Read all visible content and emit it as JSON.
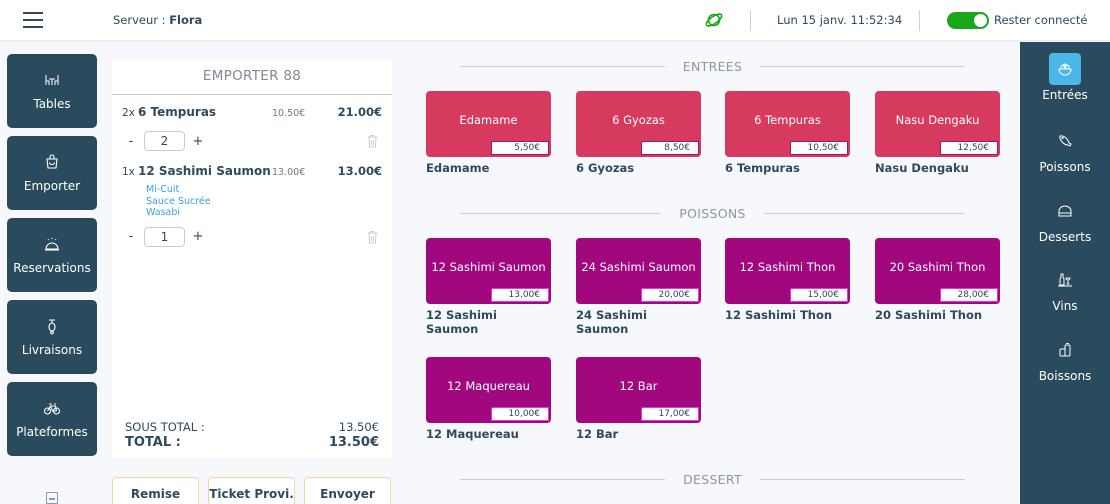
{
  "topbar": {
    "server_label": "Serveur : ",
    "server_name": "Flora",
    "datetime": "Lun 15 janv. 11:52:34",
    "stay_connected_label": "Rester connecté",
    "stay_connected": true,
    "accent_green": "#18a61a"
  },
  "leftnav": [
    {
      "label": "Tables",
      "icon": "table-icon"
    },
    {
      "label": "Emporter",
      "icon": "bag-icon"
    },
    {
      "label": "Reservations",
      "icon": "bell-icon"
    },
    {
      "label": "Livraisons",
      "icon": "scooter-icon"
    },
    {
      "label": "Plateformes",
      "icon": "bicycle-icon"
    }
  ],
  "order": {
    "title": "EMPORTER 88",
    "lines": [
      {
        "qty_label": "2x",
        "name": "6 Tempuras",
        "unit_price": "10.50€",
        "total": "21.00€",
        "options": [],
        "qty": "2"
      },
      {
        "qty_label": "1x",
        "name": "12 Sashimi Saumon",
        "unit_price": "13.00€",
        "total": "13.00€",
        "options": [
          "Mi-Cuit",
          "Sauce Sucrée",
          "Wasabi"
        ],
        "qty": "1"
      }
    ],
    "stepper_minus": "-",
    "stepper_plus": "+",
    "subtotal_label": "SOUS TOTAL :",
    "subtotal_value": "13.50€",
    "total_label": "TOTAL :",
    "total_value": "13.50€"
  },
  "actions": {
    "discount": "Remise",
    "provisional_ticket": "Ticket Provi.",
    "send": "Envoyer"
  },
  "menu": {
    "sections": [
      {
        "title": "ENTREES",
        "color": "#d73a5f",
        "products": [
          {
            "name": "Edamame",
            "price": "5,50€",
            "caption": "Edamame"
          },
          {
            "name": "6 Gyozas",
            "price": "8,50€",
            "caption": "6 Gyozas"
          },
          {
            "name": "6 Tempuras",
            "price": "10,50€",
            "caption": "6 Tempuras"
          },
          {
            "name": "Nasu Dengaku",
            "price": "12,50€",
            "caption": "Nasu Dengaku"
          }
        ]
      },
      {
        "title": "POISSONS",
        "color": "#a2087e",
        "products": [
          {
            "name": "12 Sashimi Saumon",
            "price": "13,00€",
            "caption": "12 Sashimi Saumon"
          },
          {
            "name": "24 Sashimi Saumon",
            "price": "20,00€",
            "caption": "24 Sashimi Saumon"
          },
          {
            "name": "12 Sashimi Thon",
            "price": "15,00€",
            "caption": "12 Sashimi Thon"
          },
          {
            "name": "20 Sashimi Thon",
            "price": "28,00€",
            "caption": "20 Sashimi Thon"
          },
          {
            "name": "12 Maquereau",
            "price": "10,00€",
            "caption": "12 Maquereau"
          },
          {
            "name": "12 Bar",
            "price": "17,00€",
            "caption": "12 Bar"
          }
        ]
      },
      {
        "title": "DESSERT",
        "products": []
      }
    ]
  },
  "categories": [
    {
      "label": "Entrées",
      "icon": "salad-bowl-icon",
      "active": true
    },
    {
      "label": "Poissons",
      "icon": "fish-icon",
      "active": false
    },
    {
      "label": "Desserts",
      "icon": "cake-icon",
      "active": false
    },
    {
      "label": "Vins",
      "icon": "wine-icon",
      "active": false
    },
    {
      "label": "Boissons",
      "icon": "drinks-icon",
      "active": false
    }
  ]
}
